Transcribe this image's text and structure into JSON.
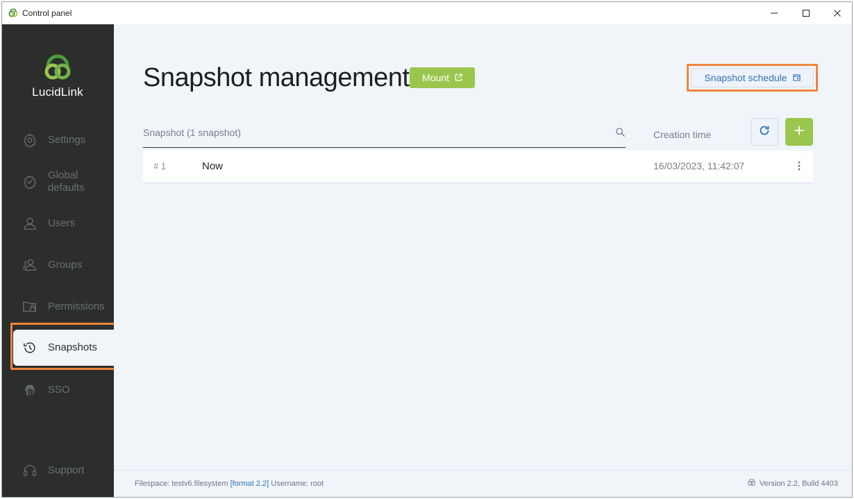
{
  "window": {
    "title": "Control panel"
  },
  "sidebar": {
    "logo_text": "LucidLink",
    "items": [
      {
        "label": "Settings",
        "icon": "gear-icon"
      },
      {
        "label": "Global\ndefaults",
        "icon": "gear-badge-icon"
      },
      {
        "label": "Users",
        "icon": "user-icon"
      },
      {
        "label": "Groups",
        "icon": "group-icon"
      },
      {
        "label": "Permissions",
        "icon": "folder-lock-icon"
      },
      {
        "label": "Snapshots",
        "icon": "history-clock-icon",
        "active": true
      },
      {
        "label": "SSO",
        "icon": "fingerprint-icon"
      },
      {
        "label": "Support",
        "icon": "headset-icon"
      }
    ]
  },
  "main": {
    "title": "Snapshot management",
    "mount_label": "Mount",
    "schedule_label": "Snapshot schedule",
    "list": {
      "column_snapshot": "Snapshot (1 snapshot)",
      "column_creation": "Creation time",
      "rows": [
        {
          "number": "# 1",
          "name": "Now",
          "time": "16/03/2023, 11:42:07"
        }
      ]
    }
  },
  "footer": {
    "filespace_prefix": "Filespace: testv6.filesystem ",
    "format": "[format 2.2]",
    "username": " Username: root",
    "version": "Version 2.2, Build 4403"
  },
  "colors": {
    "accent_green": "#9ac64e",
    "highlight_orange": "#f0843d",
    "link_blue": "#2e74b8",
    "sidebar_bg": "#2b2e2b",
    "main_bg": "#f1f5fa"
  }
}
